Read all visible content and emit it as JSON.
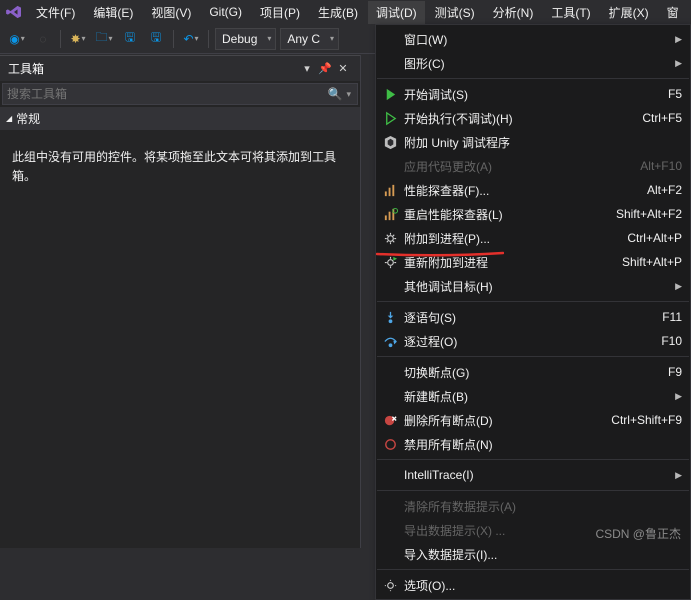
{
  "menubar": {
    "items": [
      {
        "label": "文件(F)"
      },
      {
        "label": "编辑(E)"
      },
      {
        "label": "视图(V)"
      },
      {
        "label": "Git(G)"
      },
      {
        "label": "项目(P)"
      },
      {
        "label": "生成(B)"
      },
      {
        "label": "调试(D)"
      },
      {
        "label": "测试(S)"
      },
      {
        "label": "分析(N)"
      },
      {
        "label": "工具(T)"
      },
      {
        "label": "扩展(X)"
      },
      {
        "label": "窗"
      }
    ]
  },
  "toolbar": {
    "config": "Debug",
    "platform": "Any C"
  },
  "toolbox": {
    "title": "工具箱",
    "search_placeholder": "搜索工具箱",
    "group": "常规",
    "empty": "此组中没有可用的控件。将某项拖至此文本可将其添加到工具箱。"
  },
  "menu_items": [
    {
      "label": "窗口(W)",
      "submenu": true
    },
    {
      "label": "图形(C)",
      "submenu": true
    },
    {
      "sep": true
    },
    {
      "icon": "play-green",
      "label": "开始调试(S)",
      "shortcut": "F5"
    },
    {
      "icon": "play-hollow",
      "label": "开始执行(不调试)(H)",
      "shortcut": "Ctrl+F5"
    },
    {
      "icon": "unity",
      "label": "附加 Unity 调试程序"
    },
    {
      "label": "应用代码更改(A)",
      "shortcut": "Alt+F10",
      "disabled": true
    },
    {
      "icon": "perf",
      "label": "性能探查器(F)...",
      "shortcut": "Alt+F2"
    },
    {
      "icon": "perf-restart",
      "label": "重启性能探查器(L)",
      "shortcut": "Shift+Alt+F2"
    },
    {
      "icon": "gear",
      "label": "附加到进程(P)...",
      "shortcut": "Ctrl+Alt+P"
    },
    {
      "icon": "gear-reattach",
      "label": "重新附加到进程",
      "shortcut": "Shift+Alt+P"
    },
    {
      "label": "其他调试目标(H)",
      "submenu": true
    },
    {
      "sep": true
    },
    {
      "icon": "step-into",
      "label": "逐语句(S)",
      "shortcut": "F11"
    },
    {
      "icon": "step-over",
      "label": "逐过程(O)",
      "shortcut": "F10"
    },
    {
      "sep": true
    },
    {
      "label": "切换断点(G)",
      "shortcut": "F9"
    },
    {
      "label": "新建断点(B)",
      "submenu": true
    },
    {
      "icon": "bp-delete",
      "label": "删除所有断点(D)",
      "shortcut": "Ctrl+Shift+F9"
    },
    {
      "icon": "bp-disable",
      "label": "禁用所有断点(N)"
    },
    {
      "sep": true
    },
    {
      "label": "IntelliTrace(I)",
      "submenu": true
    },
    {
      "sep": true
    },
    {
      "label": "清除所有数据提示(A)",
      "disabled": true
    },
    {
      "label": "导出数据提示(X) ...",
      "disabled": true
    },
    {
      "label": "导入数据提示(I)..."
    },
    {
      "sep": true
    },
    {
      "icon": "gear-simple",
      "label": "选项(O)..."
    }
  ],
  "watermark": "CSDN @鲁正杰"
}
